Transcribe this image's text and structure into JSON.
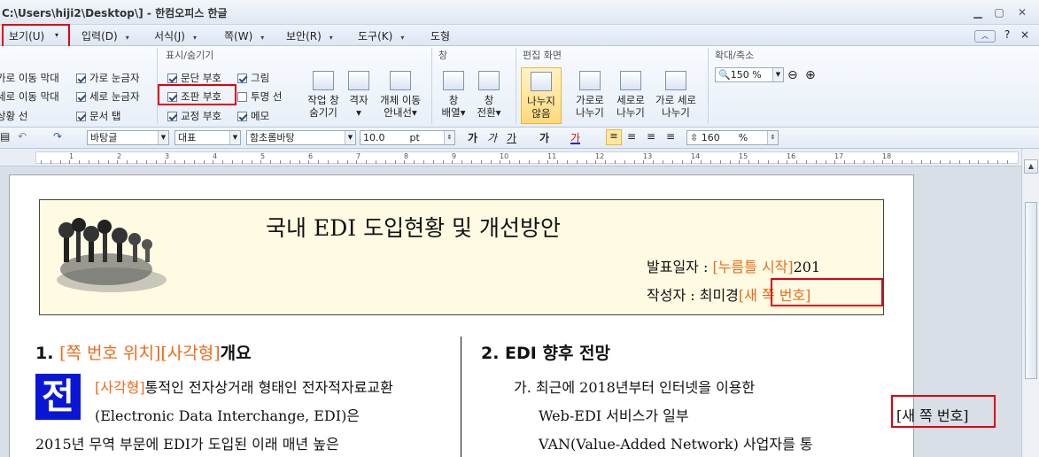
{
  "window": {
    "title": "C:\\Users\\hiji2\\Desktop\\] - 한컴오피스 한글",
    "minimize": "▁",
    "restore": "▢",
    "close": "✕"
  },
  "menubar": {
    "items": [
      {
        "label": "보기(U)"
      },
      {
        "label": "입력(D)"
      },
      {
        "label": "서식(J)"
      },
      {
        "label": "쪽(W)"
      },
      {
        "label": "보안(R)"
      },
      {
        "label": "도구(K)"
      },
      {
        "label": "도형"
      }
    ],
    "right": [
      "?",
      "×"
    ]
  },
  "ribbon": {
    "groups": {
      "show_hide": "표시/숨기기",
      "window": "창",
      "edit_screen": "편집 화면",
      "zoom": "확대/축소"
    },
    "left_checks": [
      {
        "label": "가로 이동 막대",
        "checked": true
      },
      {
        "label": "세로 이동 막대",
        "checked": true
      },
      {
        "label": "상황 선",
        "checked": true
      }
    ],
    "ruler_checks": [
      {
        "label": "가로 눈금자",
        "checked": true
      },
      {
        "label": "세로 눈금자",
        "checked": true
      },
      {
        "label": "문서 탭",
        "checked": true
      }
    ],
    "mark_checks": [
      {
        "label": "문단 부호",
        "checked": true
      },
      {
        "label": "조판 부호",
        "checked": true
      },
      {
        "label": "교정 부호",
        "checked": true
      }
    ],
    "other_checks": [
      {
        "label": "그림",
        "checked": true
      },
      {
        "label": "투명 선",
        "checked": false
      },
      {
        "label": "메모",
        "checked": true
      }
    ],
    "buttons": [
      {
        "line1": "작업 창",
        "line2": "숨기기"
      },
      {
        "line1": "격자",
        "line2": "▾"
      },
      {
        "line1": "개체 이동",
        "line2": "안내선▾"
      },
      {
        "line1": "창",
        "line2": "배열▾"
      },
      {
        "line1": "창",
        "line2": "전환▾"
      },
      {
        "line1": "나누지",
        "line2": "않음"
      },
      {
        "line1": "가로로",
        "line2": "나누기"
      },
      {
        "line1": "세로로",
        "line2": "나누기"
      },
      {
        "line1": "가로 세로",
        "line2": "나누기"
      }
    ],
    "zoom_value": "150 %"
  },
  "toolbar": {
    "style": "바탕글",
    "lang": "대표",
    "font": "함초롬바탕",
    "size": "10.0",
    "unit": "pt",
    "bold": "가",
    "italic": "가",
    "underline": "가",
    "strike": "가",
    "color": "가",
    "line_spacing": "160",
    "line_unit": "%"
  },
  "ruler": {
    "numbers": [
      "1",
      "2",
      "3",
      "4",
      "5",
      "6",
      "7",
      "8",
      "9",
      "10",
      "11",
      "12",
      "13",
      "14",
      "15",
      "16",
      "17",
      "18"
    ]
  },
  "doc": {
    "title": "국내 EDI 도입현황 및 개선방안",
    "date_label": "발표일자 : ",
    "date_field": "[누름틀 시작]",
    "date_tail": "201",
    "author_label": "작성자 : 최미경",
    "author_field": "[새 쪽 번호]",
    "s1_num": "1. ",
    "s1_field": "[쪽 번호 위치][사각형]",
    "s1_title": "개요",
    "initial": "전",
    "p1_field": "[사각형]",
    "p1_l1": "통적인 전자상거래 형태인 전자적자료교환",
    "p1_l2": "(Electronic  Data  Interchange,  EDI)은",
    "p1_l3": "2015년 무역 부문에 EDI가 도입된 이래 매년 높은",
    "s2_title": "2. EDI 향후 전망",
    "p2_l1": "가.  최근에    2018년부터    인터넷을    이용한",
    "p2_l2": "Web-EDI          서비스가          일부",
    "p2_field": "[새 쪽 번호]",
    "p2_l3": "VAN(Value-Added Network) 사업자를 통"
  },
  "colors": {
    "highlight": "#e1000f",
    "field": "#ea6c1c",
    "initial_bg": "#0a16d6"
  }
}
